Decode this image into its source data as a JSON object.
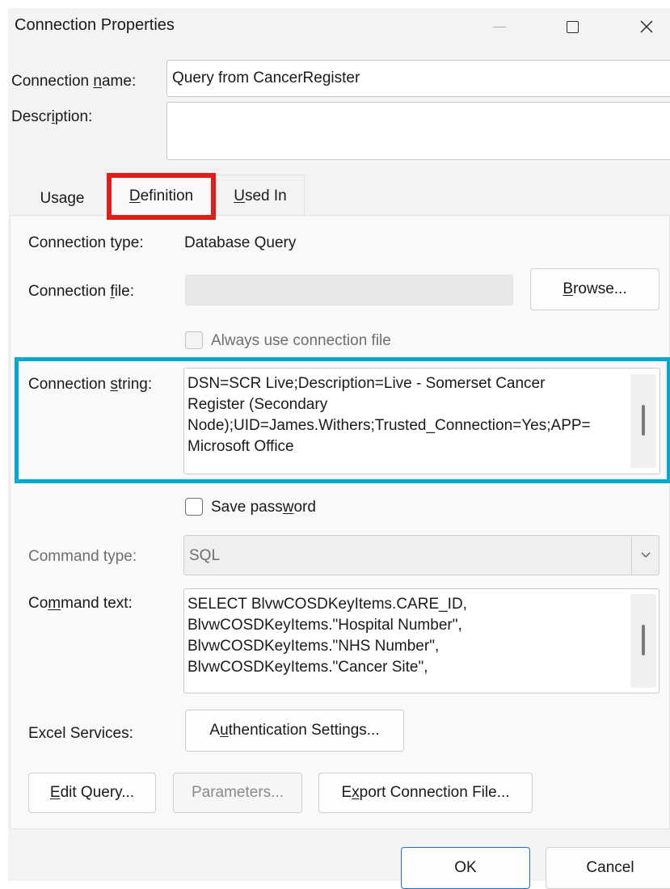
{
  "window": {
    "title": "Connection Properties"
  },
  "connection": {
    "name_label_pre": "Connection ",
    "name_label_ul": "n",
    "name_label_post": "ame:",
    "name_value": "Query from CancerRegister",
    "description_label_pre": "Descr",
    "description_label_ul": "i",
    "description_label_post": "ption:",
    "description_value": ""
  },
  "tabs": [
    {
      "pre": "Usa",
      "ul": "g",
      "post": "e"
    },
    {
      "pre": "",
      "ul": "D",
      "post": "efinition"
    },
    {
      "pre": "",
      "ul": "U",
      "post": "sed In"
    }
  ],
  "definition": {
    "type_label": "Connection type:",
    "type_value": "Database Query",
    "file_label_pre": "Connection ",
    "file_label_ul": "f",
    "file_label_post": "ile:",
    "file_value": "",
    "browse_pre": "",
    "browse_ul": "B",
    "browse_post": "rowse...",
    "always_use_label": "Always use connection file",
    "string_label_pre": "Connection ",
    "string_label_ul": "s",
    "string_label_post": "tring:",
    "string_value": "DSN=SCR Live;Description=Live - Somerset Cancer\nRegister (Secondary\nNode);UID=James.Withers;Trusted_Connection=Yes;APP=\nMicrosoft Office",
    "save_password_pre": "Save pass",
    "save_password_ul": "w",
    "save_password_post": "ord",
    "command_type_label": "Command type:",
    "command_type_value": "SQL",
    "command_text_label_pre": "Co",
    "command_text_label_ul": "m",
    "command_text_label_post": "mand text:",
    "command_text_value": "SELECT BlvwCOSDKeyItems.CARE_ID,\nBlvwCOSDKeyItems.\"Hospital Number\",\nBlvwCOSDKeyItems.\"NHS Number\",\nBlvwCOSDKeyItems.\"Cancer Site\",",
    "excel_services_label": "Excel Services:",
    "auth_pre": "A",
    "auth_ul": "u",
    "auth_post": "thentication Settings...",
    "edit_query_pre": "",
    "edit_query_ul": "E",
    "edit_query_post": "dit Query...",
    "parameters_label": "Parameters...",
    "export_pre": "E",
    "export_ul": "x",
    "export_post": "port Connection File..."
  },
  "footer": {
    "ok_label": "OK",
    "cancel_label": "Cancel"
  },
  "annotations": {
    "tab_highlight_color": "#e21b1b",
    "string_highlight_color": "#00a7cf"
  }
}
